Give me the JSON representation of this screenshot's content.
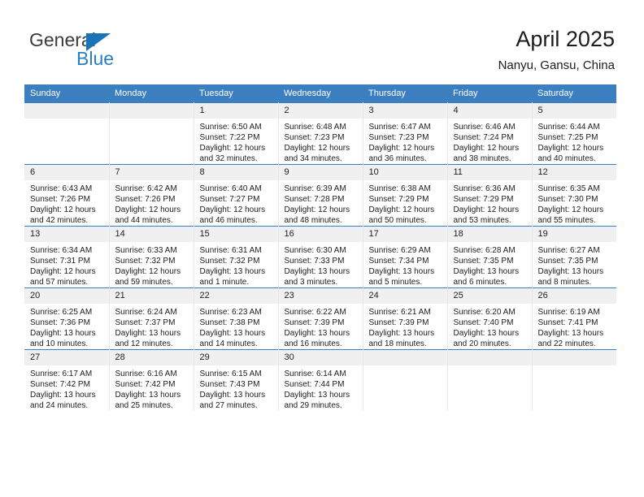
{
  "logo": {
    "primary_text": "General",
    "secondary_text": "Blue",
    "triangle_icon": "blue-triangle-icon",
    "primary_color": "#3b3b3b",
    "secondary_color": "#2a7ec1"
  },
  "header": {
    "title": "April 2025",
    "subtitle": "Nanyu, Gansu, China"
  },
  "theme": {
    "header_bg": "#3c7fc1",
    "header_text": "#ffffff",
    "datenum_bg": "#f0f0f0",
    "cell_bg": "#ffffff",
    "grid_line": "#e6e6e6"
  },
  "weekday_headers": [
    "Sunday",
    "Monday",
    "Tuesday",
    "Wednesday",
    "Thursday",
    "Friday",
    "Saturday"
  ],
  "weeks": [
    [
      {
        "day": "",
        "sunrise": "",
        "sunset": "",
        "daylight_line1": "",
        "daylight_line2": ""
      },
      {
        "day": "",
        "sunrise": "",
        "sunset": "",
        "daylight_line1": "",
        "daylight_line2": ""
      },
      {
        "day": "1",
        "sunrise": "Sunrise: 6:50 AM",
        "sunset": "Sunset: 7:22 PM",
        "daylight_line1": "Daylight: 12 hours",
        "daylight_line2": "and 32 minutes."
      },
      {
        "day": "2",
        "sunrise": "Sunrise: 6:48 AM",
        "sunset": "Sunset: 7:23 PM",
        "daylight_line1": "Daylight: 12 hours",
        "daylight_line2": "and 34 minutes."
      },
      {
        "day": "3",
        "sunrise": "Sunrise: 6:47 AM",
        "sunset": "Sunset: 7:23 PM",
        "daylight_line1": "Daylight: 12 hours",
        "daylight_line2": "and 36 minutes."
      },
      {
        "day": "4",
        "sunrise": "Sunrise: 6:46 AM",
        "sunset": "Sunset: 7:24 PM",
        "daylight_line1": "Daylight: 12 hours",
        "daylight_line2": "and 38 minutes."
      },
      {
        "day": "5",
        "sunrise": "Sunrise: 6:44 AM",
        "sunset": "Sunset: 7:25 PM",
        "daylight_line1": "Daylight: 12 hours",
        "daylight_line2": "and 40 minutes."
      }
    ],
    [
      {
        "day": "6",
        "sunrise": "Sunrise: 6:43 AM",
        "sunset": "Sunset: 7:26 PM",
        "daylight_line1": "Daylight: 12 hours",
        "daylight_line2": "and 42 minutes."
      },
      {
        "day": "7",
        "sunrise": "Sunrise: 6:42 AM",
        "sunset": "Sunset: 7:26 PM",
        "daylight_line1": "Daylight: 12 hours",
        "daylight_line2": "and 44 minutes."
      },
      {
        "day": "8",
        "sunrise": "Sunrise: 6:40 AM",
        "sunset": "Sunset: 7:27 PM",
        "daylight_line1": "Daylight: 12 hours",
        "daylight_line2": "and 46 minutes."
      },
      {
        "day": "9",
        "sunrise": "Sunrise: 6:39 AM",
        "sunset": "Sunset: 7:28 PM",
        "daylight_line1": "Daylight: 12 hours",
        "daylight_line2": "and 48 minutes."
      },
      {
        "day": "10",
        "sunrise": "Sunrise: 6:38 AM",
        "sunset": "Sunset: 7:29 PM",
        "daylight_line1": "Daylight: 12 hours",
        "daylight_line2": "and 50 minutes."
      },
      {
        "day": "11",
        "sunrise": "Sunrise: 6:36 AM",
        "sunset": "Sunset: 7:29 PM",
        "daylight_line1": "Daylight: 12 hours",
        "daylight_line2": "and 53 minutes."
      },
      {
        "day": "12",
        "sunrise": "Sunrise: 6:35 AM",
        "sunset": "Sunset: 7:30 PM",
        "daylight_line1": "Daylight: 12 hours",
        "daylight_line2": "and 55 minutes."
      }
    ],
    [
      {
        "day": "13",
        "sunrise": "Sunrise: 6:34 AM",
        "sunset": "Sunset: 7:31 PM",
        "daylight_line1": "Daylight: 12 hours",
        "daylight_line2": "and 57 minutes."
      },
      {
        "day": "14",
        "sunrise": "Sunrise: 6:33 AM",
        "sunset": "Sunset: 7:32 PM",
        "daylight_line1": "Daylight: 12 hours",
        "daylight_line2": "and 59 minutes."
      },
      {
        "day": "15",
        "sunrise": "Sunrise: 6:31 AM",
        "sunset": "Sunset: 7:32 PM",
        "daylight_line1": "Daylight: 13 hours",
        "daylight_line2": "and 1 minute."
      },
      {
        "day": "16",
        "sunrise": "Sunrise: 6:30 AM",
        "sunset": "Sunset: 7:33 PM",
        "daylight_line1": "Daylight: 13 hours",
        "daylight_line2": "and 3 minutes."
      },
      {
        "day": "17",
        "sunrise": "Sunrise: 6:29 AM",
        "sunset": "Sunset: 7:34 PM",
        "daylight_line1": "Daylight: 13 hours",
        "daylight_line2": "and 5 minutes."
      },
      {
        "day": "18",
        "sunrise": "Sunrise: 6:28 AM",
        "sunset": "Sunset: 7:35 PM",
        "daylight_line1": "Daylight: 13 hours",
        "daylight_line2": "and 6 minutes."
      },
      {
        "day": "19",
        "sunrise": "Sunrise: 6:27 AM",
        "sunset": "Sunset: 7:35 PM",
        "daylight_line1": "Daylight: 13 hours",
        "daylight_line2": "and 8 minutes."
      }
    ],
    [
      {
        "day": "20",
        "sunrise": "Sunrise: 6:25 AM",
        "sunset": "Sunset: 7:36 PM",
        "daylight_line1": "Daylight: 13 hours",
        "daylight_line2": "and 10 minutes."
      },
      {
        "day": "21",
        "sunrise": "Sunrise: 6:24 AM",
        "sunset": "Sunset: 7:37 PM",
        "daylight_line1": "Daylight: 13 hours",
        "daylight_line2": "and 12 minutes."
      },
      {
        "day": "22",
        "sunrise": "Sunrise: 6:23 AM",
        "sunset": "Sunset: 7:38 PM",
        "daylight_line1": "Daylight: 13 hours",
        "daylight_line2": "and 14 minutes."
      },
      {
        "day": "23",
        "sunrise": "Sunrise: 6:22 AM",
        "sunset": "Sunset: 7:39 PM",
        "daylight_line1": "Daylight: 13 hours",
        "daylight_line2": "and 16 minutes."
      },
      {
        "day": "24",
        "sunrise": "Sunrise: 6:21 AM",
        "sunset": "Sunset: 7:39 PM",
        "daylight_line1": "Daylight: 13 hours",
        "daylight_line2": "and 18 minutes."
      },
      {
        "day": "25",
        "sunrise": "Sunrise: 6:20 AM",
        "sunset": "Sunset: 7:40 PM",
        "daylight_line1": "Daylight: 13 hours",
        "daylight_line2": "and 20 minutes."
      },
      {
        "day": "26",
        "sunrise": "Sunrise: 6:19 AM",
        "sunset": "Sunset: 7:41 PM",
        "daylight_line1": "Daylight: 13 hours",
        "daylight_line2": "and 22 minutes."
      }
    ],
    [
      {
        "day": "27",
        "sunrise": "Sunrise: 6:17 AM",
        "sunset": "Sunset: 7:42 PM",
        "daylight_line1": "Daylight: 13 hours",
        "daylight_line2": "and 24 minutes."
      },
      {
        "day": "28",
        "sunrise": "Sunrise: 6:16 AM",
        "sunset": "Sunset: 7:42 PM",
        "daylight_line1": "Daylight: 13 hours",
        "daylight_line2": "and 25 minutes."
      },
      {
        "day": "29",
        "sunrise": "Sunrise: 6:15 AM",
        "sunset": "Sunset: 7:43 PM",
        "daylight_line1": "Daylight: 13 hours",
        "daylight_line2": "and 27 minutes."
      },
      {
        "day": "30",
        "sunrise": "Sunrise: 6:14 AM",
        "sunset": "Sunset: 7:44 PM",
        "daylight_line1": "Daylight: 13 hours",
        "daylight_line2": "and 29 minutes."
      },
      {
        "day": "",
        "sunrise": "",
        "sunset": "",
        "daylight_line1": "",
        "daylight_line2": ""
      },
      {
        "day": "",
        "sunrise": "",
        "sunset": "",
        "daylight_line1": "",
        "daylight_line2": ""
      },
      {
        "day": "",
        "sunrise": "",
        "sunset": "",
        "daylight_line1": "",
        "daylight_line2": ""
      }
    ]
  ]
}
